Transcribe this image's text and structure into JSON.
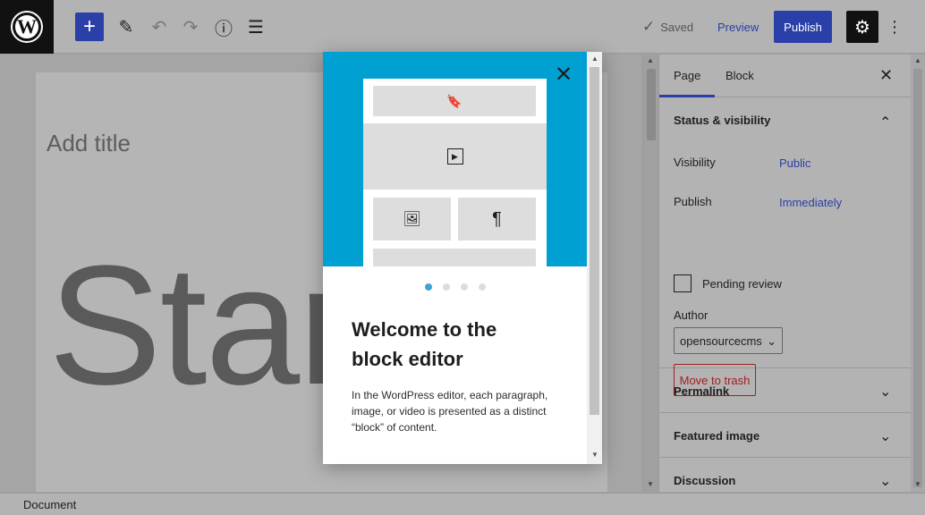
{
  "toolbar": {
    "logo_glyph": "W",
    "inserter_glyph": "+",
    "tools_glyph": "✎",
    "undo_glyph": "↶",
    "redo_glyph": "↷",
    "info_glyph": "ⓘ",
    "outline_glyph": "☰",
    "saved_label": "Saved",
    "check_glyph": "✓",
    "preview_label": "Preview",
    "publish_label": "Publish",
    "settings_glyph": "⚙",
    "more_glyph": "⋮"
  },
  "canvas": {
    "title_placeholder": "Add title",
    "big_text": "Star"
  },
  "sidebar": {
    "tabs": [
      {
        "label": "Page",
        "active": true
      },
      {
        "label": "Block",
        "active": false
      }
    ],
    "close_glyph": "✕",
    "status_panel": {
      "title": "Status & visibility",
      "chevron": "⌃",
      "visibility_label": "Visibility",
      "visibility_value": "Public",
      "publish_label": "Publish",
      "publish_value": "Immediately",
      "pending_label": "Pending review",
      "pending_checked": false,
      "author_label": "Author",
      "author_value": "opensourcecms",
      "select_caret": "⌄",
      "trash_label": "Move to trash"
    },
    "collapsed_panels": [
      {
        "title": "Permalink",
        "chevron": "⌄"
      },
      {
        "title": "Featured image",
        "chevron": "⌄"
      },
      {
        "title": "Discussion",
        "chevron": "⌄"
      }
    ]
  },
  "statusbar": {
    "label": "Document"
  },
  "modal": {
    "close_glyph": "✕",
    "blocks": {
      "bookmark_glyph": "🔖",
      "play_glyph": "▶",
      "image_glyph": "🖼",
      "pilcrow_glyph": "¶"
    },
    "pages_total": 4,
    "page_active": 1,
    "title": "Welcome to the block editor",
    "body": "In the WordPress editor, each paragraph, image, or video is presented as a distinct “block” of content."
  },
  "colors": {
    "accent": "#2a3fa8",
    "hero": "#00a0d2",
    "danger": "#a0201f"
  }
}
